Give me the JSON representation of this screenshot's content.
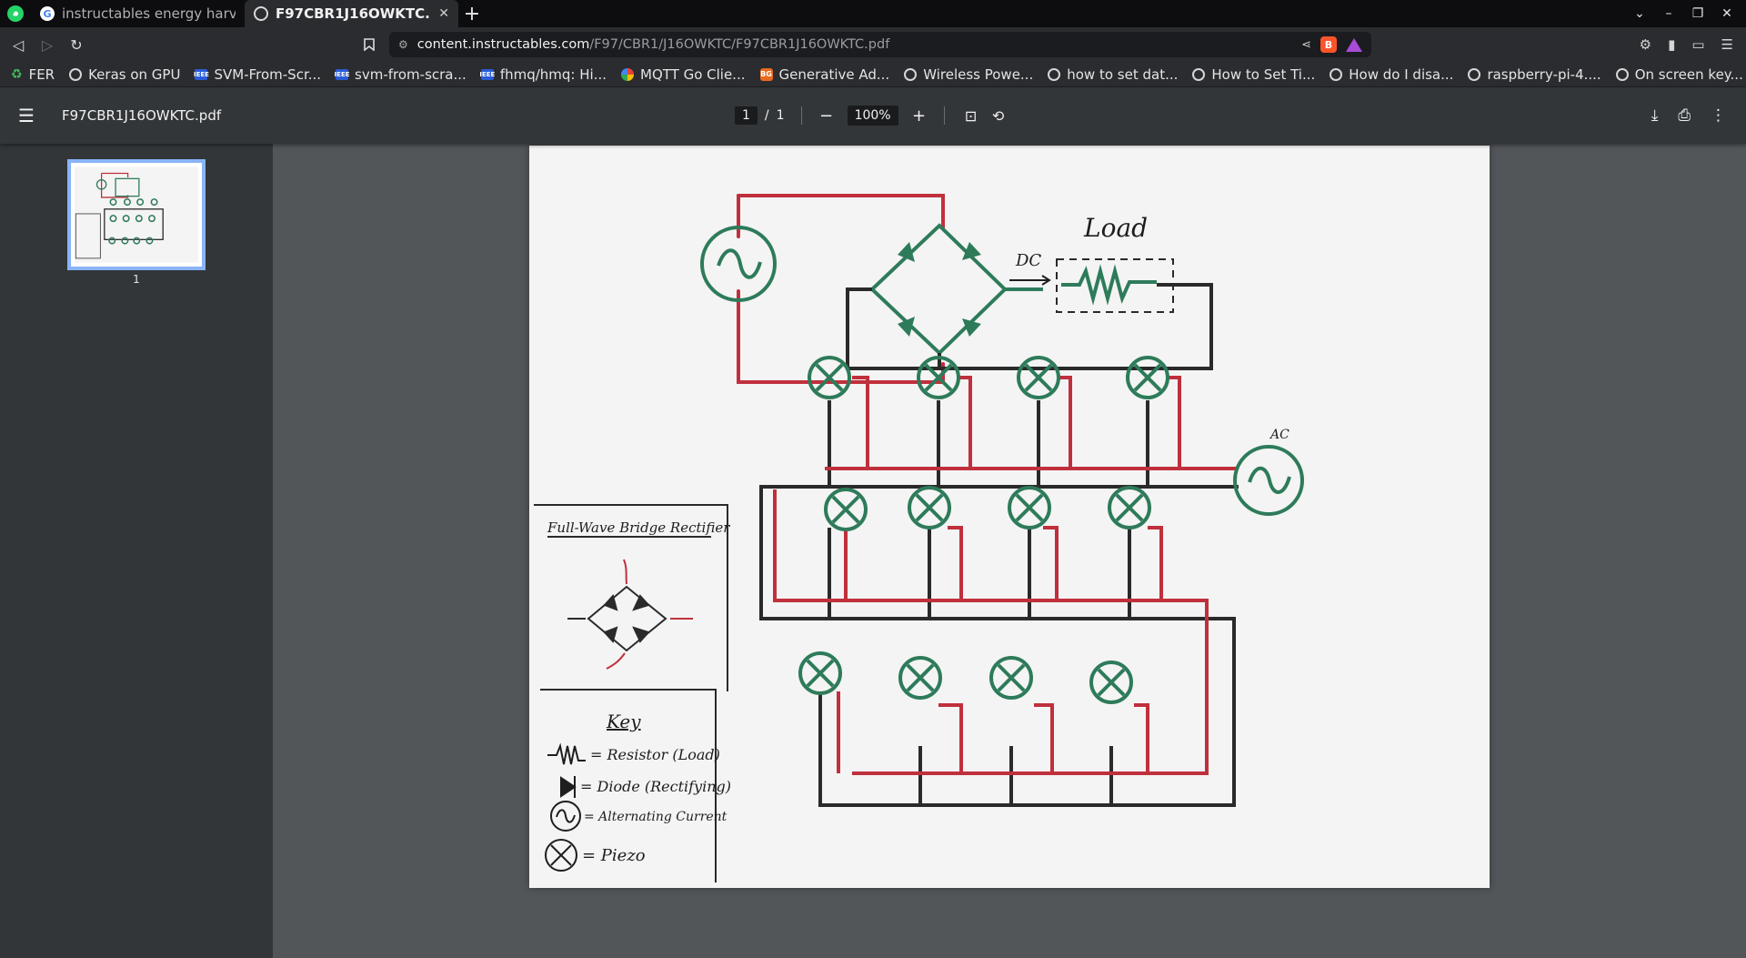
{
  "tabs": [
    {
      "title": "instructables energy harveste",
      "icon": "google-icon"
    },
    {
      "title": "F97CBR1J16OWKTC.pdf",
      "icon": "globe-icon"
    }
  ],
  "address": {
    "host": "content.instructables.com",
    "path": "/F97/CBR1/J16OWKTC/F97CBR1J16OWKTC.pdf"
  },
  "bookmarks": [
    {
      "label": "FER",
      "icon": "fer-icon"
    },
    {
      "label": "Keras on GPU",
      "icon": "globe-icon"
    },
    {
      "label": "SVM-From-Scr...",
      "icon": "ieee-icon"
    },
    {
      "label": "svm-from-scra...",
      "icon": "ieee-icon"
    },
    {
      "label": "fhmq/hmq: Hi...",
      "icon": "ieee-icon"
    },
    {
      "label": "MQTT Go Clie...",
      "icon": "mqtt-icon"
    },
    {
      "label": "Generative Ad...",
      "icon": "bg-icon"
    },
    {
      "label": "Wireless Powe...",
      "icon": "globe-icon"
    },
    {
      "label": "how to set dat...",
      "icon": "globe-icon"
    },
    {
      "label": "How to Set Ti...",
      "icon": "globe-icon"
    },
    {
      "label": "How do I disa...",
      "icon": "globe-icon"
    },
    {
      "label": "raspberry-pi-4....",
      "icon": "globe-icon"
    },
    {
      "label": "On screen key...",
      "icon": "globe-icon"
    }
  ],
  "viewer": {
    "file_name": "F97CBR1J16OWKTC.pdf",
    "current_page": "1",
    "page_separator": "/",
    "total_pages": "1",
    "zoom": "100%",
    "thumbnail_label": "1"
  },
  "drawing": {
    "load_label": "Load",
    "dc_label": "DC",
    "ac_label": "AC",
    "legend_title": "Full-Wave Bridge Rectifier",
    "key_title": "Key",
    "key_items": [
      "= Resistor (Load)",
      "= Diode (Rectifying)",
      "= Alternating Current",
      "= Piezo"
    ]
  },
  "colors": {
    "red_wire": "#c0303c",
    "black_wire": "#2a2a2a",
    "green_ink": "#2e7b5a",
    "accent_thumb": "#8ab4f8"
  }
}
